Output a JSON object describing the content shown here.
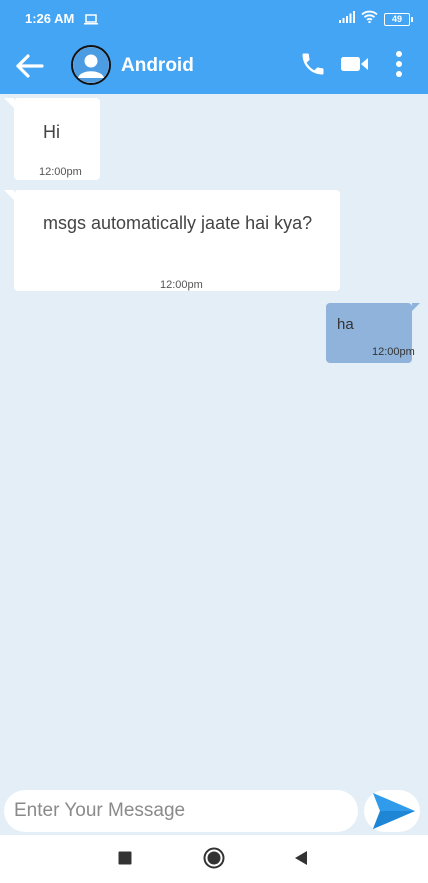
{
  "status_bar": {
    "time": "1:26 AM",
    "battery": "49",
    "icons": [
      "laptop-icon",
      "signal-icon",
      "wifi-icon",
      "battery-icon"
    ]
  },
  "app_bar": {
    "title": "Android",
    "icons": [
      "back-arrow-icon",
      "avatar-icon",
      "call-icon",
      "video-icon",
      "more-vertical-icon"
    ],
    "accent_color": "#43a5f4"
  },
  "messages": [
    {
      "direction": "received",
      "text": "Hi",
      "time": "12:00pm"
    },
    {
      "direction": "received",
      "text": "msgs automatically jaate hai kya?",
      "time": "12:00pm"
    },
    {
      "direction": "sent",
      "text": "ha",
      "time": "12:00pm"
    }
  ],
  "composer": {
    "placeholder": "Enter Your Message",
    "send_icon": "send-icon"
  },
  "nav_bar": {
    "icons": [
      "recents-square-icon",
      "home-circle-icon",
      "back-triangle-icon"
    ]
  },
  "colors": {
    "chat_background": "#e3eef6",
    "received_bubble": "#ffffff",
    "sent_bubble": "#8fb3da",
    "send_button": "#2f9bea"
  }
}
